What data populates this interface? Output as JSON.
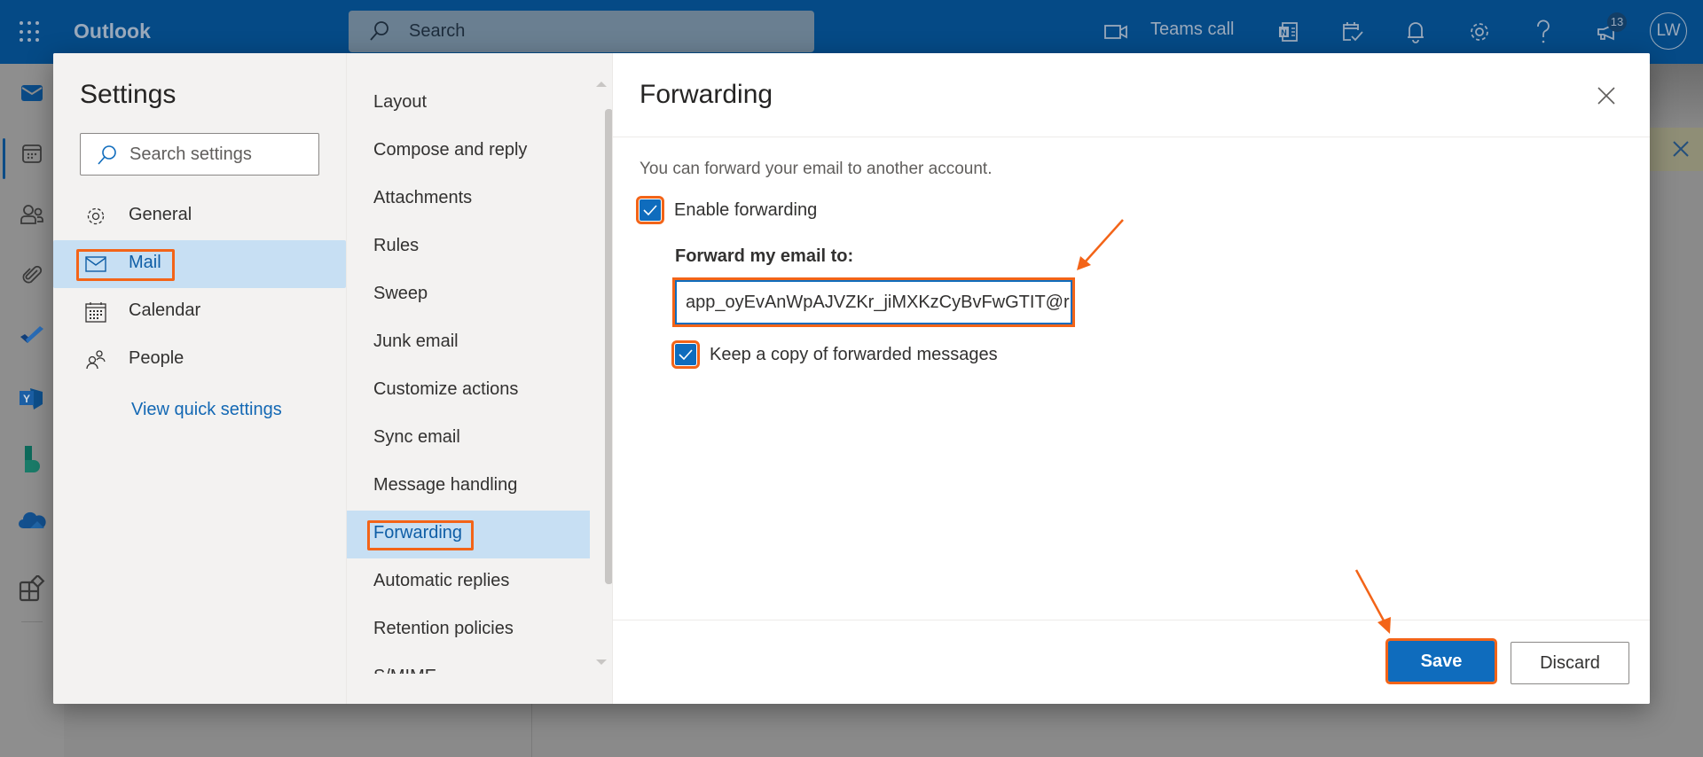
{
  "app": {
    "name": "Outlook",
    "search_placeholder": "Search",
    "teams_call_label": "Teams call",
    "notification_badge": "13",
    "avatar_initials": "LW"
  },
  "settings": {
    "title": "Settings",
    "search_placeholder": "Search settings",
    "categories": [
      {
        "label": "General",
        "icon": "gear-icon"
      },
      {
        "label": "Mail",
        "icon": "mail-icon",
        "active": true
      },
      {
        "label": "Calendar",
        "icon": "calendar-icon"
      },
      {
        "label": "People",
        "icon": "people-icon"
      }
    ],
    "quick_settings_link": "View quick settings",
    "mail_subsections": [
      {
        "label": "Layout"
      },
      {
        "label": "Compose and reply"
      },
      {
        "label": "Attachments"
      },
      {
        "label": "Rules"
      },
      {
        "label": "Sweep"
      },
      {
        "label": "Junk email"
      },
      {
        "label": "Customize actions"
      },
      {
        "label": "Sync email"
      },
      {
        "label": "Message handling"
      },
      {
        "label": "Forwarding",
        "active": true
      },
      {
        "label": "Automatic replies"
      },
      {
        "label": "Retention policies"
      },
      {
        "label": "S/MIME"
      }
    ]
  },
  "forwarding": {
    "title": "Forwarding",
    "description": "You can forward your email to another account.",
    "enable_forwarding_label": "Enable forwarding",
    "enable_forwarding_checked": true,
    "forward_to_label": "Forward my email to:",
    "forward_to_value": "app_oyEvAnWpAJVZKr_jiMXKzCyBvFwGTIT@r",
    "keep_copy_label": "Keep a copy of forwarded messages",
    "keep_copy_checked": true,
    "save_label": "Save",
    "discard_label": "Discard"
  },
  "colors": {
    "header_blue": "#054a86",
    "accent_blue": "#0f6cbd",
    "selected_bg": "#c7dff3",
    "highlight_orange": "#f36418"
  }
}
